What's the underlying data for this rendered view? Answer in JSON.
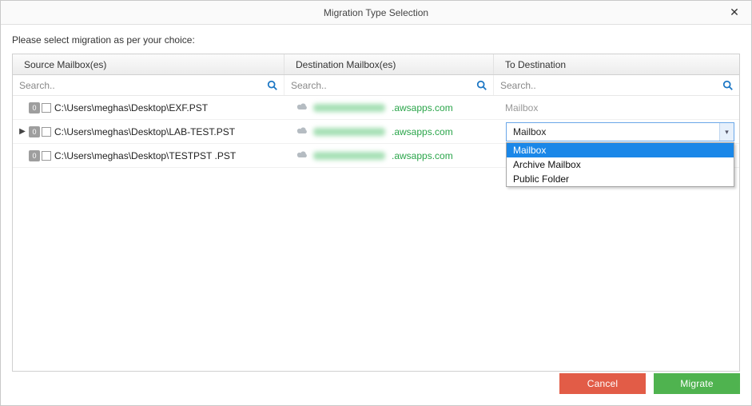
{
  "window": {
    "title": "Migration Type Selection",
    "close_glyph": "✕"
  },
  "instruction": "Please select migration as per your choice:",
  "columns": {
    "source": "Source Mailbox(es)",
    "destination": "Destination Mailbox(es)",
    "to_destination": "To Destination"
  },
  "search": {
    "placeholder": "Search.."
  },
  "rows": [
    {
      "badge": "0",
      "source_path": "C:\\Users\\meghas\\Desktop\\EXF.PST",
      "dest_domain": ".awsapps.com",
      "to_destination": "Mailbox",
      "active": false
    },
    {
      "badge": "0",
      "source_path": "C:\\Users\\meghas\\Desktop\\LAB-TEST.PST",
      "dest_domain": ".awsapps.com",
      "to_destination": "Mailbox",
      "active": true
    },
    {
      "badge": "0",
      "source_path": "C:\\Users\\meghas\\Desktop\\TESTPST .PST",
      "dest_domain": ".awsapps.com",
      "to_destination": "",
      "active": false
    }
  ],
  "combo": {
    "value": "Mailbox",
    "options": [
      "Mailbox",
      "Archive Mailbox",
      "Public Folder"
    ],
    "open": true,
    "selected_index": 0
  },
  "buttons": {
    "cancel": "Cancel",
    "migrate": "Migrate"
  }
}
